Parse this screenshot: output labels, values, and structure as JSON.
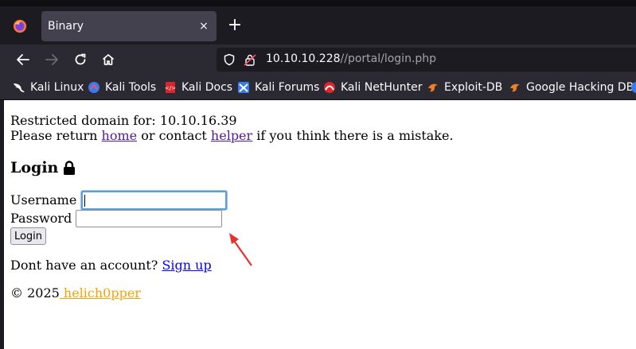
{
  "browser": {
    "tab_title": "Binary",
    "tab_close": "×",
    "new_tab": "+",
    "url_host": "10.10.10.228",
    "url_path": "//portal/login.php",
    "bookmarks": [
      {
        "label": "Kali Linux",
        "icon": "kali-dragon-icon"
      },
      {
        "label": "Kali Tools",
        "icon": "kali-tools-icon"
      },
      {
        "label": "Kali Docs",
        "icon": "kali-docs-icon"
      },
      {
        "label": "Kali Forums",
        "icon": "kali-forums-icon"
      },
      {
        "label": "Kali NetHunter",
        "icon": "nethunter-icon"
      },
      {
        "label": "Exploit-DB",
        "icon": "exploit-db-icon"
      },
      {
        "label": "Google Hacking DB",
        "icon": "ghdb-icon"
      }
    ]
  },
  "page": {
    "restricted_text": "Restricted domain for: 10.10.16.39",
    "return_prefix": "Please return ",
    "home_link": "home",
    "contact_text": " or contact ",
    "helper_link": "helper",
    "mistake_text": " if you think there is a mistake.",
    "login_heading": "Login",
    "username_label": "Username",
    "username_value": "",
    "password_label": "Password",
    "password_value": "",
    "login_button": "Login",
    "signup_prefix": "Dont have an account? ",
    "signup_link": "Sign up",
    "copyright": "© 2025",
    "author_link": " helich0pper"
  },
  "colors": {
    "visited_link": "#551a8b",
    "unvisited_link": "#0000ee",
    "author_link": "#f5a20a",
    "annotation_arrow": "#e8312f"
  }
}
